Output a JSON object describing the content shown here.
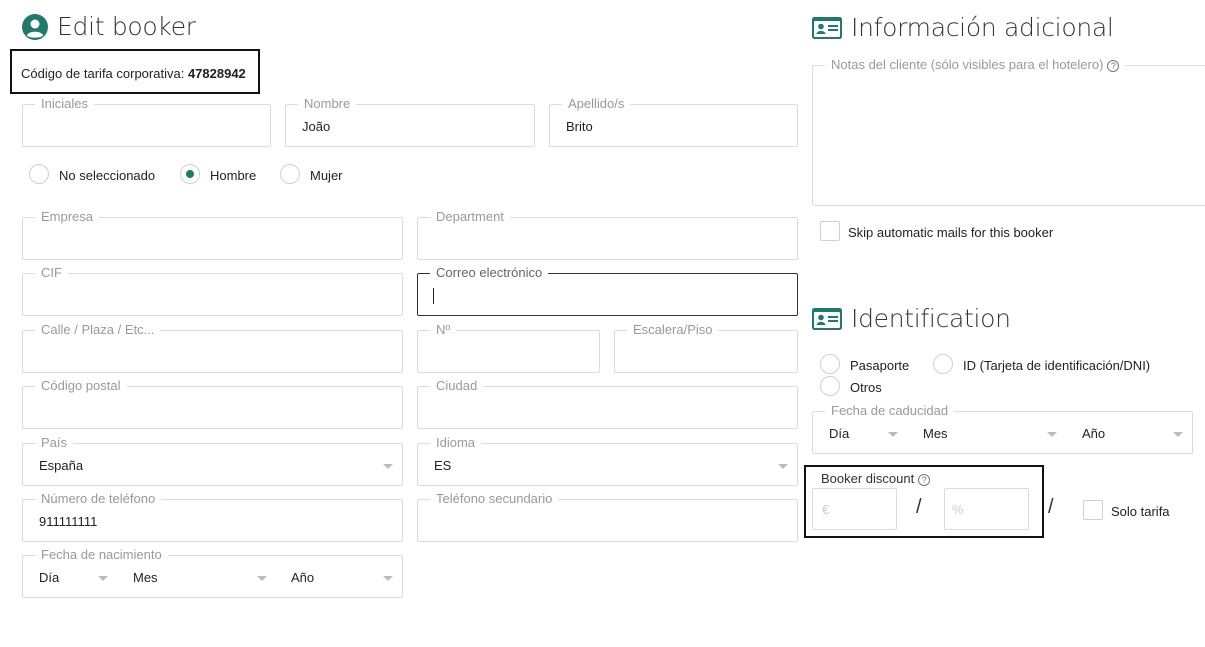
{
  "edit_booker": {
    "title": "Edit booker",
    "corporate_rate_label": "Código de tarifa corporativa:",
    "corporate_rate_value": "47828942",
    "iniciales": {
      "label": "Iniciales",
      "value": ""
    },
    "nombre": {
      "label": "Nombre",
      "value": "João"
    },
    "apellido": {
      "label": "Apellido/s",
      "value": "Brito"
    },
    "gender": {
      "options": [
        "No seleccionado",
        "Hombre",
        "Mujer"
      ],
      "selected": "Hombre"
    },
    "empresa": {
      "label": "Empresa",
      "value": ""
    },
    "department": {
      "label": "Department",
      "value": ""
    },
    "cif": {
      "label": "CIF",
      "value": ""
    },
    "correo": {
      "label": "Correo electrónico",
      "value": ""
    },
    "calle": {
      "label": "Calle / Plaza / Etc...",
      "value": ""
    },
    "numero": {
      "label": "Nº",
      "value": ""
    },
    "escalera": {
      "label": "Escalera/Piso",
      "value": ""
    },
    "codigo_postal": {
      "label": "Código postal",
      "value": ""
    },
    "ciudad": {
      "label": "Ciudad",
      "value": ""
    },
    "pais": {
      "label": "País",
      "value": "España"
    },
    "idioma": {
      "label": "Idioma",
      "value": "ES"
    },
    "telefono": {
      "label": "Número de teléfono",
      "value": "911111111"
    },
    "telefono_secundario": {
      "label": "Teléfono secundario",
      "value": ""
    },
    "fecha_nacimiento": {
      "label": "Fecha de nacimiento",
      "dia": "Día",
      "mes": "Mes",
      "ano": "Año"
    }
  },
  "info_adicional": {
    "title": "Información adicional",
    "notas_label": "Notas del cliente (sólo visibles para el hotelero)",
    "skip_mails_label": "Skip automatic mails for this booker"
  },
  "identification": {
    "title": "Identification",
    "options": [
      "Pasaporte",
      "ID (Tarjeta de identificación/DNI)",
      "Otros"
    ],
    "fecha_caducidad": {
      "label": "Fecha de caducidad",
      "dia": "Día",
      "mes": "Mes",
      "ano": "Año"
    }
  },
  "booker_discount": {
    "label": "Booker discount",
    "euro_placeholder": "€",
    "pct_placeholder": "%",
    "separator": "/",
    "solo_tarifa_label": "Solo tarifa"
  },
  "icons": {
    "user": "user-circle-icon",
    "id_card": "id-card-icon",
    "help": "question-circle-icon",
    "dropdown": "chevron-down-icon"
  },
  "colors": {
    "accent": "#1f7a6b",
    "border": "#dcdcdc",
    "label": "#999999"
  }
}
